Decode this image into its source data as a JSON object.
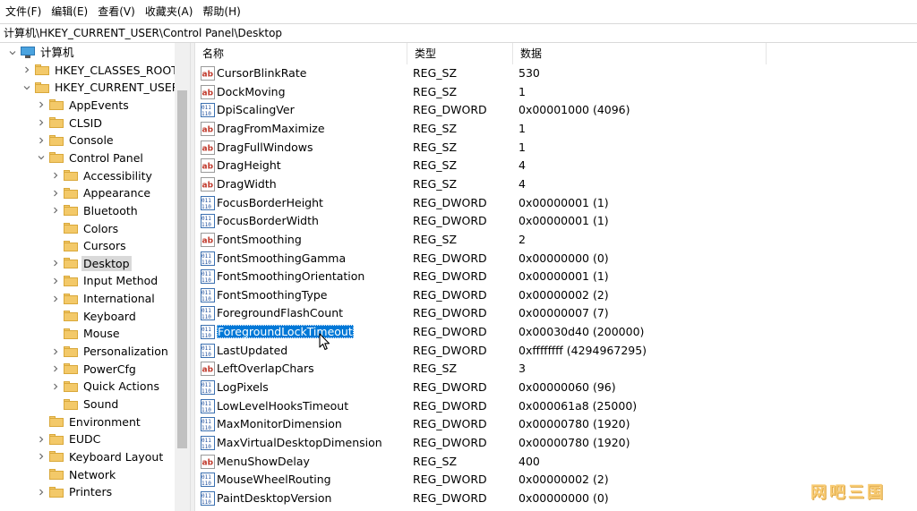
{
  "menu": [
    "文件(F)",
    "编辑(E)",
    "查看(V)",
    "收藏夹(A)",
    "帮助(H)"
  ],
  "address": "计算机\\HKEY_CURRENT_USER\\Control Panel\\Desktop",
  "tree": [
    {
      "label": "计算机",
      "level": 0,
      "expander": "down",
      "icon": "computer-icon"
    },
    {
      "label": "HKEY_CLASSES_ROOT",
      "level": 1,
      "expander": "right",
      "icon": "folder-icon"
    },
    {
      "label": "HKEY_CURRENT_USER",
      "level": 1,
      "expander": "down",
      "icon": "folder-icon"
    },
    {
      "label": "AppEvents",
      "level": 2,
      "expander": "right",
      "icon": "folder-icon"
    },
    {
      "label": "CLSID",
      "level": 2,
      "expander": "right",
      "icon": "folder-icon"
    },
    {
      "label": "Console",
      "level": 2,
      "expander": "right",
      "icon": "folder-icon"
    },
    {
      "label": "Control Panel",
      "level": 2,
      "expander": "down",
      "icon": "folder-icon"
    },
    {
      "label": "Accessibility",
      "level": 3,
      "expander": "right",
      "icon": "folder-icon"
    },
    {
      "label": "Appearance",
      "level": 3,
      "expander": "right",
      "icon": "folder-icon"
    },
    {
      "label": "Bluetooth",
      "level": 3,
      "expander": "right",
      "icon": "folder-icon"
    },
    {
      "label": "Colors",
      "level": 3,
      "expander": "none",
      "icon": "folder-icon"
    },
    {
      "label": "Cursors",
      "level": 3,
      "expander": "none",
      "icon": "folder-icon"
    },
    {
      "label": "Desktop",
      "level": 3,
      "expander": "right",
      "icon": "folder-icon",
      "selected": true
    },
    {
      "label": "Input Method",
      "level": 3,
      "expander": "right",
      "icon": "folder-icon"
    },
    {
      "label": "International",
      "level": 3,
      "expander": "right",
      "icon": "folder-icon"
    },
    {
      "label": "Keyboard",
      "level": 3,
      "expander": "none",
      "icon": "folder-icon"
    },
    {
      "label": "Mouse",
      "level": 3,
      "expander": "none",
      "icon": "folder-icon"
    },
    {
      "label": "Personalization",
      "level": 3,
      "expander": "right",
      "icon": "folder-icon"
    },
    {
      "label": "PowerCfg",
      "level": 3,
      "expander": "right",
      "icon": "folder-icon"
    },
    {
      "label": "Quick Actions",
      "level": 3,
      "expander": "right",
      "icon": "folder-icon"
    },
    {
      "label": "Sound",
      "level": 3,
      "expander": "none",
      "icon": "folder-icon"
    },
    {
      "label": "Environment",
      "level": 2,
      "expander": "none",
      "icon": "folder-icon"
    },
    {
      "label": "EUDC",
      "level": 2,
      "expander": "right",
      "icon": "folder-icon"
    },
    {
      "label": "Keyboard Layout",
      "level": 2,
      "expander": "right",
      "icon": "folder-icon"
    },
    {
      "label": "Network",
      "level": 2,
      "expander": "none",
      "icon": "folder-icon"
    },
    {
      "label": "Printers",
      "level": 2,
      "expander": "right",
      "icon": "folder-icon"
    }
  ],
  "columns": {
    "name": "名称",
    "type": "类型",
    "data": "数据"
  },
  "values": [
    {
      "name": "CursorBlinkRate",
      "type": "REG_SZ",
      "data": "530"
    },
    {
      "name": "DockMoving",
      "type": "REG_SZ",
      "data": "1"
    },
    {
      "name": "DpiScalingVer",
      "type": "REG_DWORD",
      "data": "0x00001000 (4096)"
    },
    {
      "name": "DragFromMaximize",
      "type": "REG_SZ",
      "data": "1"
    },
    {
      "name": "DragFullWindows",
      "type": "REG_SZ",
      "data": "1"
    },
    {
      "name": "DragHeight",
      "type": "REG_SZ",
      "data": "4"
    },
    {
      "name": "DragWidth",
      "type": "REG_SZ",
      "data": "4"
    },
    {
      "name": "FocusBorderHeight",
      "type": "REG_DWORD",
      "data": "0x00000001 (1)"
    },
    {
      "name": "FocusBorderWidth",
      "type": "REG_DWORD",
      "data": "0x00000001 (1)"
    },
    {
      "name": "FontSmoothing",
      "type": "REG_SZ",
      "data": "2"
    },
    {
      "name": "FontSmoothingGamma",
      "type": "REG_DWORD",
      "data": "0x00000000 (0)"
    },
    {
      "name": "FontSmoothingOrientation",
      "type": "REG_DWORD",
      "data": "0x00000001 (1)"
    },
    {
      "name": "FontSmoothingType",
      "type": "REG_DWORD",
      "data": "0x00000002 (2)"
    },
    {
      "name": "ForegroundFlashCount",
      "type": "REG_DWORD",
      "data": "0x00000007 (7)"
    },
    {
      "name": "ForegroundLockTimeout",
      "type": "REG_DWORD",
      "data": "0x00030d40 (200000)",
      "selected": true
    },
    {
      "name": "LastUpdated",
      "type": "REG_DWORD",
      "data": "0xffffffff (4294967295)"
    },
    {
      "name": "LeftOverlapChars",
      "type": "REG_SZ",
      "data": "3"
    },
    {
      "name": "LogPixels",
      "type": "REG_DWORD",
      "data": "0x00000060 (96)"
    },
    {
      "name": "LowLevelHooksTimeout",
      "type": "REG_DWORD",
      "data": "0x000061a8 (25000)"
    },
    {
      "name": "MaxMonitorDimension",
      "type": "REG_DWORD",
      "data": "0x00000780 (1920)"
    },
    {
      "name": "MaxVirtualDesktopDimension",
      "type": "REG_DWORD",
      "data": "0x00000780 (1920)"
    },
    {
      "name": "MenuShowDelay",
      "type": "REG_SZ",
      "data": "400"
    },
    {
      "name": "MouseWheelRouting",
      "type": "REG_DWORD",
      "data": "0x00000002 (2)"
    },
    {
      "name": "PaintDesktopVersion",
      "type": "REG_DWORD",
      "data": "0x00000000 (0)"
    }
  ],
  "watermark": "网吧三国"
}
